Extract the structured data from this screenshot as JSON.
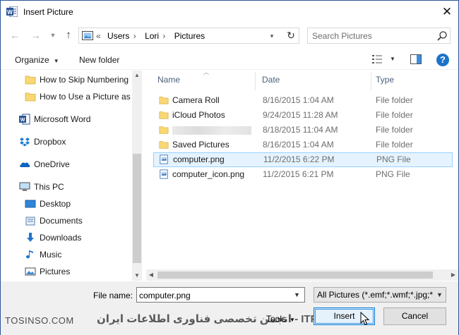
{
  "window": {
    "title": "Insert Picture"
  },
  "address": {
    "crumbs": [
      "Users",
      "Lori",
      "Pictures"
    ]
  },
  "search": {
    "placeholder": "Search Pictures"
  },
  "toolbar": {
    "organize_label": "Organize",
    "new_folder_label": "New folder",
    "help_label": "?"
  },
  "nav": {
    "items": [
      {
        "label": "How to Skip Numbering",
        "icon": "folder-icon"
      },
      {
        "label": "How to Use a Picture as t",
        "icon": "folder-icon"
      },
      {
        "label": "Microsoft Word",
        "icon": "word-icon"
      },
      {
        "label": "Dropbox",
        "icon": "dropbox-icon"
      },
      {
        "label": "OneDrive",
        "icon": "onedrive-icon"
      },
      {
        "label": "This PC",
        "icon": "computer-icon"
      },
      {
        "label": "Desktop",
        "icon": "desktop-icon"
      },
      {
        "label": "Documents",
        "icon": "documents-icon"
      },
      {
        "label": "Downloads",
        "icon": "downloads-icon"
      },
      {
        "label": "Music",
        "icon": "music-icon"
      },
      {
        "label": "Pictures",
        "icon": "pictures-icon"
      }
    ]
  },
  "files": {
    "columns": [
      "Name",
      "Date",
      "Type"
    ],
    "rows": [
      {
        "name": "Camera Roll",
        "date": "8/16/2015 1:04 AM",
        "type": "File folder",
        "icon": "folder-icon"
      },
      {
        "name": "iCloud Photos",
        "date": "9/24/2015 11:28 AM",
        "type": "File folder",
        "icon": "folder-icon"
      },
      {
        "name": "",
        "date": "8/18/2015 11:04 AM",
        "type": "File folder",
        "icon": "folder-icon"
      },
      {
        "name": "Saved Pictures",
        "date": "8/16/2015 1:04 AM",
        "type": "File folder",
        "icon": "folder-icon"
      },
      {
        "name": "computer.png",
        "date": "11/2/2015 6:22 PM",
        "type": "PNG File",
        "icon": "image-file-icon"
      },
      {
        "name": "computer_icon.png",
        "date": "11/2/2015 6:21 PM",
        "type": "PNG File",
        "icon": "image-file-icon"
      }
    ]
  },
  "bottom": {
    "file_name_label": "File name:",
    "file_name_value": "computer.png",
    "file_type_value": "All Pictures (*.emf;*.wmf;*.jpg;*",
    "tools_label": "Tools",
    "insert_label": "Insert",
    "cancel_label": "Cancel"
  },
  "watermark": {
    "left": "TOSINSO.COM",
    "right": "انجمن تخصصی فناوری اطلاعات ایران - ITPro.ir"
  },
  "colors": {
    "accent": "#0078d7",
    "selection": "#e5f3ff",
    "folder": "#f8d775"
  }
}
